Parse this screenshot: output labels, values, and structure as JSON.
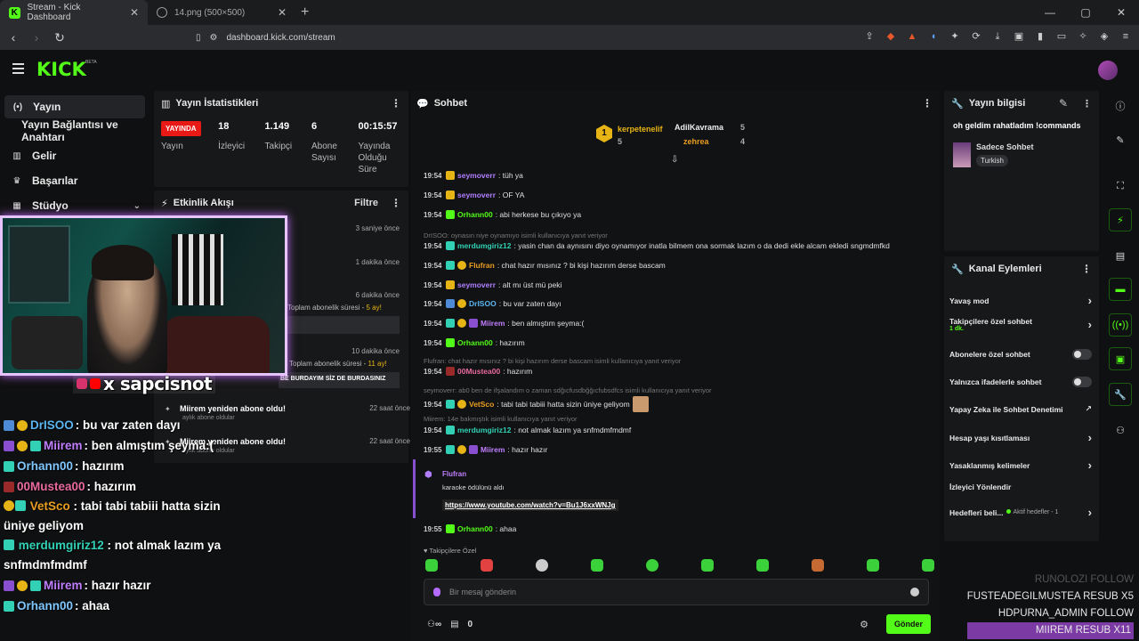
{
  "browser": {
    "tabs": [
      {
        "title": "Stream - Kick Dashboard",
        "active": true
      },
      {
        "title": "14.png (500×500)",
        "active": false
      }
    ],
    "url": "dashboard.kick.com/stream"
  },
  "header": {
    "logo": "KICK",
    "beta": "BETA"
  },
  "sidebar": {
    "items": [
      {
        "label": "Yayın",
        "icon": "broadcast-icon"
      },
      {
        "label": "Yayın Bağlantısı ve Anahtarı",
        "icon": ""
      },
      {
        "label": "Gelir",
        "icon": "revenue-icon"
      },
      {
        "label": "Başarılar",
        "icon": "trophy-icon"
      },
      {
        "label": "Stüdyo",
        "icon": "studio-icon"
      }
    ]
  },
  "stats": {
    "title": "Yayın İstatistikleri",
    "live_label": "YAYINDA",
    "live_sub": "Yayın",
    "viewers": "18",
    "viewers_label": "İzleyici",
    "followers": "1.149",
    "followers_label": "Takipçi",
    "subs": "6",
    "subs_label": "Abone Sayısı",
    "uptime": "00:15:57",
    "uptime_label": "Yayında Olduğu Süre"
  },
  "activity": {
    "title": "Etkinlik Akışı",
    "filter": "Filtre",
    "times": [
      "3 saniye önce",
      "1 dakika önce",
      "6 dakika önce",
      "10 dakika önce",
      "22 saat önce",
      "22 saat önce"
    ],
    "frag1": "Toplam abonelik süresi - ",
    "frag1_val": "5 ay!",
    "frag2": "Toplam abonelik süresi - ",
    "frag2_val": "11 ay!",
    "frag3": "BE BURDAYIM SİZ DE BURDASINIZ",
    "resub1": "Miirem yeniden abone oldu!",
    "resub1_sub": "aylık abone oldular",
    "resub2": "Miirem yeniden abone oldu!",
    "resub2_sub": "aylık abone oldular"
  },
  "overlay": {
    "social_handle": "x sapcisnot",
    "chat": [
      {
        "user": "DrISOO",
        "msg": " : bu var zaten dayı"
      },
      {
        "user": "Miirem",
        "msg": " : ben almıştım şeyma:("
      },
      {
        "user": "Orhann00",
        "msg": " : hazırım"
      },
      {
        "user": "00Mustea00",
        "msg": " : hazırım"
      },
      {
        "user": "VetSco",
        "msg": " : tabi tabi tabiii hatta sizin üniye geliyom"
      },
      {
        "user": "merdumgiriz12",
        "msg": " : not almak lazım ya snfmdmfmdmf"
      },
      {
        "user": "Miirem",
        "msg": " : hazır hazır"
      },
      {
        "user": "Orhann00",
        "msg": " : ahaa"
      }
    ],
    "alerts": [
      {
        "text": "RUNOLOZI  FOLLOW"
      },
      {
        "text": "FUSTEADEGILMUSTEA  RESUB X5"
      },
      {
        "text": "HDPURNA_ADMIN  FOLLOW"
      },
      {
        "text": "MIIREM  RESUB X11"
      }
    ]
  },
  "chat": {
    "title": "Sohbet",
    "gifters": {
      "first_name": "kerpetenelif",
      "first_count": "5",
      "second_name": "AdilKavrama",
      "second_count": "5",
      "third_name": "zehrea",
      "third_count": "4"
    },
    "messages": [
      {
        "time": "19:54",
        "user": "seymoverr",
        "text": ": tüh ya"
      },
      {
        "time": "19:54",
        "user": "seymoverr",
        "text": ": OF YA"
      },
      {
        "time": "19:54",
        "user": "Orhann00",
        "text": ": abi herkese bu çıkıyo ya"
      },
      {
        "reply": "DrISOO: oynasın niye oynamıyo isimli kullanıcıya yanıt veriyor"
      },
      {
        "time": "19:54",
        "user": "merdumgiriz12",
        "text": ": yasin chan da aynısını diyo oynamıyor inatla bilmem ona sormak lazım o da dedi ekle alcam ekledi sngmdmfkd"
      },
      {
        "time": "19:54",
        "user": "Flufran",
        "text": ": chat hazır mısınız ? bi kişi hazırım derse bascam"
      },
      {
        "time": "19:54",
        "user": "seymoverr",
        "text": ": alt mı üst mü peki"
      },
      {
        "time": "19:54",
        "user": "DrISOO",
        "text": ": bu var zaten dayı"
      },
      {
        "time": "19:54",
        "user": "Miirem",
        "text": ": ben almıştım şeyma:("
      },
      {
        "time": "19:54",
        "user": "Orhann00",
        "text": ": hazırım"
      },
      {
        "reply": "Flufran: chat hazır mısınız ? bi kişi hazırım derse bascam isimli kullanıcıya yanıt veriyor"
      },
      {
        "time": "19:54",
        "user": "00Mustea00",
        "text": ": hazırım"
      },
      {
        "reply": "seymoverr: ab0 ben de ifşalandım o zaman sdğıcfusdbğğıcfubsdfcs isimli kullanıcıya yanıt veriyor"
      },
      {
        "time": "19:54",
        "user": "VetSco",
        "text": ": tabi tabi tabiii hatta sizin üniye geliyom"
      },
      {
        "reply": "Miirem: 14e bakmıştık isimli kullanıcıya yanıt veriyor"
      },
      {
        "time": "19:54",
        "user": "merdumgiriz12",
        "text": ": not almak lazım ya snfmdmfmdmf"
      },
      {
        "time": "19:55",
        "user": "Miirem",
        "text": ": hazır hazır"
      }
    ],
    "redeem": {
      "user": "Flufran",
      "action": "karaoke ödülünü aldı",
      "link": "https://www.youtube.com/watch?v=Bu1J6xxWNJg"
    },
    "last": {
      "time": "19:55",
      "user": "Orhann00",
      "text": ": ahaa"
    },
    "follower_only": "Takipçilere Özel",
    "input_placeholder": "Bir mesaj gönderin",
    "points": "0",
    "send": "Gönder"
  },
  "stream_info": {
    "title": "Yayın bilgisi",
    "stream_title": "oh geldim rahatladım !commands",
    "category": "Sadece Sohbet",
    "tag": "Turkish"
  },
  "channel_actions": {
    "title": "Kanal Eylemleri",
    "items": [
      {
        "label": "Yavaş mod"
      },
      {
        "label": "Takipçilere özel sohbet",
        "sub": "1 dk."
      },
      {
        "label": "Abonelere özel sohbet"
      },
      {
        "label": "Yalnızca ifadelerle sohbet"
      },
      {
        "label": "Yapay Zeka ile Sohbet Denetimi"
      },
      {
        "label": "Hesap yaşı kısıtlaması"
      },
      {
        "label": "Yasaklanmış kelimeler"
      },
      {
        "label": "İzleyici Yönlendir"
      },
      {
        "label": "Hedefleri beli...",
        "note": "Aktif hedefler - 1"
      }
    ]
  },
  "colors": {
    "accent": "#53fc18",
    "live": "#e91916",
    "sub": "#8a4fd0"
  }
}
